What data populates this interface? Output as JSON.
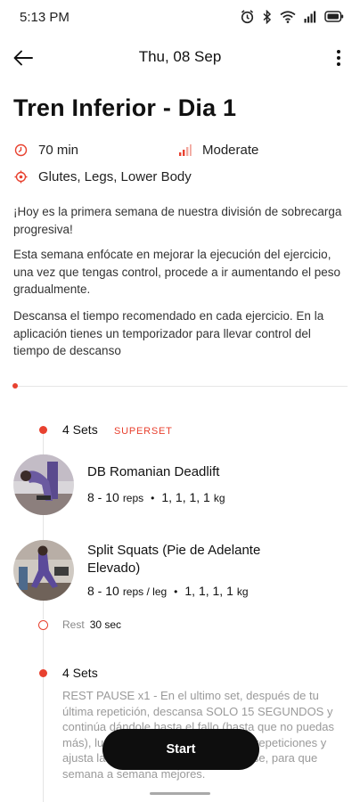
{
  "status_bar": {
    "time": "5:13 PM",
    "icons": [
      "alarm-icon",
      "bluetooth-icon",
      "wifi-icon",
      "signal-icon",
      "battery-icon"
    ]
  },
  "header": {
    "date": "Thu, 08 Sep",
    "back_icon": "arrow-left-icon",
    "menu_icon": "more-vertical-icon"
  },
  "workout": {
    "title": "Tren Inferior - Dia 1",
    "duration": "70 min",
    "intensity": "Moderate",
    "muscles": "Glutes, Legs, Lower Body",
    "description": [
      "¡Hoy es la primera semana de nuestra división de sobrecarga progresiva!",
      "Esta semana enfócate en mejorar la ejecución del ejercicio, una vez que tengas control, procede a ir aumentando el peso gradualmente.",
      "Descansa el tiempo recomendado en cada ejercicio. En la aplicación tienes un temporizador para llevar control del tiempo de descanso"
    ]
  },
  "blocks": [
    {
      "sets": "4 Sets",
      "tag": "SUPERSET",
      "exercises": [
        {
          "name": "DB Romanian Deadlift",
          "reps": "8 - 10",
          "reps_unit": "reps",
          "separator": "•",
          "weights": "1, 1, 1, 1",
          "weight_unit": "kg"
        },
        {
          "name": "Split Squats (Pie de Adelante Elevado)",
          "reps": "8 - 10",
          "reps_unit": "reps / leg",
          "separator": "•",
          "weights": "1, 1, 1, 1",
          "weight_unit": "kg"
        }
      ],
      "rest_label": "Rest",
      "rest_value": "30 sec"
    },
    {
      "sets": "4 Sets",
      "notes": "REST PAUSE x1  - En el ultimo set, después de tu última repetición, descansa SOLO 15 SEGUNDOS y continúa dándole hasta el fallo (hasta que no puedas más), luego toma nota del peso y las repeticiones y ajusta las que hiciste en ese rest pause, para que semana a semana mejores."
    }
  ],
  "actions": {
    "start_label": "Start"
  },
  "colors": {
    "accent": "#e8412f",
    "button": "#0e0e0e"
  }
}
